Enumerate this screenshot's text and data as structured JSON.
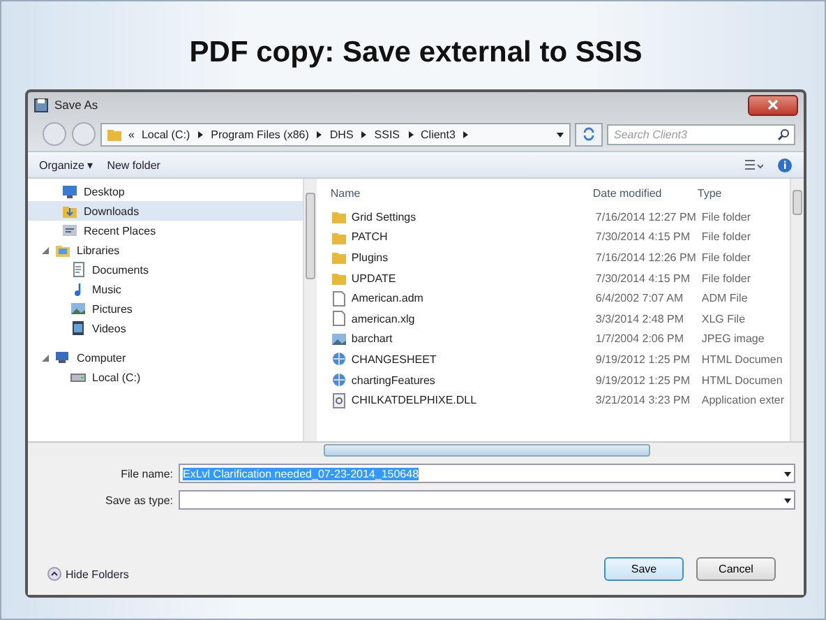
{
  "slide_title": "PDF copy: Save external to SSIS",
  "window": {
    "title": "Save As"
  },
  "address": {
    "overflow": "«",
    "crumbs": [
      "Local (C:)",
      "Program Files (x86)",
      "DHS",
      "SSIS",
      "Client3"
    ]
  },
  "search": {
    "placeholder": "Search Client3"
  },
  "toolbar": {
    "items": [
      "Organize ▾",
      "New folder"
    ]
  },
  "sidebar": {
    "items": [
      {
        "label": "Desktop",
        "kind": "desktop",
        "selected": false
      },
      {
        "label": "Downloads",
        "kind": "downloads",
        "selected": true
      },
      {
        "label": "Recent Places",
        "kind": "recent",
        "selected": false
      },
      {
        "label": "Libraries",
        "kind": "library",
        "selected": false,
        "expanded": true,
        "children": [
          {
            "label": "Documents",
            "kind": "document",
            "selected": false
          },
          {
            "label": "Music",
            "kind": "music",
            "selected": false
          },
          {
            "label": "Pictures",
            "kind": "pictures",
            "selected": false
          },
          {
            "label": "Videos",
            "kind": "videos",
            "selected": false
          }
        ]
      },
      {
        "label": "Computer",
        "kind": "computer",
        "selected": false,
        "expanded": true,
        "children": [
          {
            "label": "Local (C:)",
            "kind": "drive",
            "selected": false
          }
        ]
      }
    ]
  },
  "table": {
    "columns": [
      "Name",
      "Date modified",
      "Type"
    ],
    "rows": [
      {
        "kind": "folder",
        "cells": [
          "Grid Settings",
          "7/16/2014 12:27 PM",
          "File folder"
        ]
      },
      {
        "kind": "folder",
        "cells": [
          "PATCH",
          "7/30/2014 4:15 PM",
          "File folder"
        ]
      },
      {
        "kind": "folder",
        "cells": [
          "Plugins",
          "7/16/2014 12:26 PM",
          "File folder"
        ]
      },
      {
        "kind": "folder",
        "cells": [
          "UPDATE",
          "7/30/2014 4:15 PM",
          "File folder"
        ]
      },
      {
        "kind": "file",
        "cells": [
          "American.adm",
          "6/4/2002 7:07 AM",
          "ADM File"
        ]
      },
      {
        "kind": "file",
        "cells": [
          "american.xlg",
          "3/3/2014 2:48 PM",
          "XLG File"
        ]
      },
      {
        "kind": "image",
        "cells": [
          "barchart",
          "1/7/2004 2:06 PM",
          "JPEG image"
        ]
      },
      {
        "kind": "html",
        "cells": [
          "CHANGESHEET",
          "9/19/2012 1:25 PM",
          "HTML Documen"
        ]
      },
      {
        "kind": "html",
        "cells": [
          "chartingFeatures",
          "9/19/2012 1:25 PM",
          "HTML Documen"
        ]
      },
      {
        "kind": "dll",
        "cells": [
          "CHILKATDELPHIXE.DLL",
          "3/21/2014 3:23 PM",
          "Application exter"
        ]
      }
    ]
  },
  "file_name": {
    "label": "File name:",
    "value": "ExLvl Clarification needed_07-23-2014_150648"
  },
  "save_as_type": {
    "label": "Save as type:"
  },
  "hide_folders": "Hide Folders",
  "buttons": [
    "Save",
    "Cancel"
  ]
}
